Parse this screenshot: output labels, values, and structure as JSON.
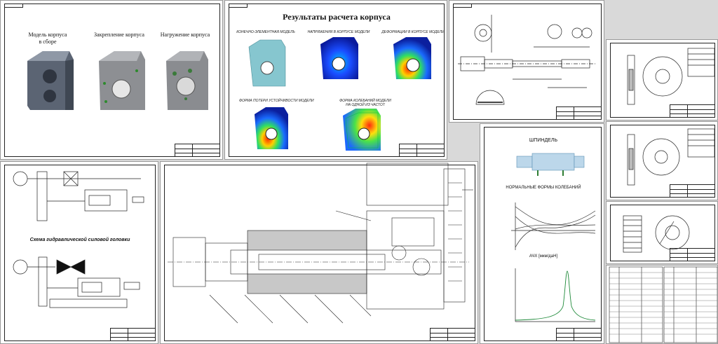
{
  "housing_assembly": {
    "model_label": "Модель корпуса\nв сборе",
    "fixing_label": "Закрепление корпуса",
    "loading_label": "Нагружение корпуса"
  },
  "housing_results": {
    "title": "Результаты расчета корпуса",
    "fe_model_label": "КОНЕЧНО-ЭЛЕМЕНТНАЯ МОДЕЛЬ",
    "stresses_label": "НАПРЯЖЕНИЯ В КОРПУСЕ МОДЕЛИ",
    "deformations_label": "ДЕФОРМАЦИИ В КОРПУСЕ МОДЕЛИ",
    "stability_label": "ФОРМА ПОТЕРИ УСТОЙЧИВОСТИ МОДЕЛИ",
    "vibration_label": "ФОРМА КОЛЕБАНИЙ МОДЕЛИ\nНА ОДНОЙ ИЗ ЧАСТОТ"
  },
  "hydraulic": {
    "scheme_title": "Схема гидравлической силовой головки"
  },
  "spindle_analysis": {
    "spindle_label": "ШПИНДЕЛЬ",
    "modes_title": "НОРМАЛЬНЫЕ ФОРМЫ КОЛЕБАНИЙ",
    "afc_title": "АЧХ [мкм/даН]"
  }
}
